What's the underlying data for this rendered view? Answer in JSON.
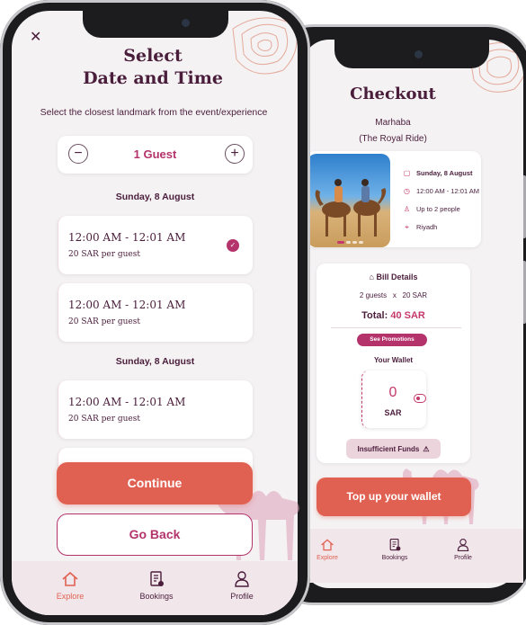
{
  "colors": {
    "primary": "#e06152",
    "accent": "#b4336b",
    "text_dark": "#4a1d3b",
    "background": "#f4f2f3"
  },
  "select_screen": {
    "title_line1": "Select",
    "title_line2": "Date and Time",
    "subtitle": "Select the closest landmark from the event/experience",
    "guest_stepper": {
      "minus": "−",
      "plus": "+",
      "value": "1 Guest"
    },
    "groups": [
      {
        "date": "Sunday, 8 August",
        "slots": [
          {
            "time": "12:00 AM - 12:01 AM",
            "price": "20 SAR per guest",
            "selected": true
          },
          {
            "time": "12:00 AM - 12:01 AM",
            "price": "20 SAR per guest",
            "selected": false
          }
        ]
      },
      {
        "date": "Sunday, 8 August",
        "slots": [
          {
            "time": "12:00 AM - 12:01 AM",
            "price": "20 SAR per guest",
            "selected": false
          }
        ]
      }
    ],
    "continue_label": "Continue",
    "go_back_label": "Go Back",
    "nav": [
      {
        "label": "Explore",
        "icon": "home-icon",
        "active": true
      },
      {
        "label": "Bookings",
        "icon": "bookings-icon",
        "active": false
      },
      {
        "label": "Profile",
        "icon": "profile-icon",
        "active": false
      }
    ]
  },
  "checkout_screen": {
    "title": "Checkout",
    "name": "Marhaba",
    "subtitle": "(The Royal Ride)",
    "details": {
      "date": "Sunday, 8 August",
      "time": "12:00 AM - 12:01 AM",
      "people": "Up to 2 people",
      "location": "Riyadh"
    },
    "bill": {
      "title": "Bill Details",
      "guests": "2 guests",
      "times": "x",
      "unit_price": "20 SAR",
      "total_label": "Total:",
      "total_amount": "40 SAR",
      "promotions_label": "See Promotions"
    },
    "wallet": {
      "label": "Your Wallet",
      "balance": "0",
      "currency": "SAR",
      "insufficient_label": "Insufficient Funds"
    },
    "top_up_label": "Top up your wallet",
    "nav": [
      {
        "label": "Explore",
        "icon": "home-icon",
        "active": true
      },
      {
        "label": "Bookings",
        "icon": "bookings-icon",
        "active": false
      },
      {
        "label": "Profile",
        "icon": "profile-icon",
        "active": false
      }
    ]
  }
}
